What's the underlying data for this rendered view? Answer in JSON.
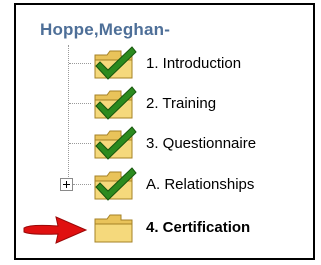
{
  "tree": {
    "user_name": "Hoppe,Meghan-",
    "items": [
      {
        "label": "1. Introduction",
        "status": "complete"
      },
      {
        "label": "2. Training",
        "status": "complete"
      },
      {
        "label": "3. Questionnaire",
        "status": "complete"
      },
      {
        "label": "A. Relationships",
        "status": "complete",
        "expandable": true
      },
      {
        "label": "4. Certification",
        "status": "current"
      }
    ]
  },
  "icons": {
    "folder": "folder-icon",
    "checkmark": "checkmark-icon",
    "expand": "plus-expander-icon",
    "pointer": "red-arrow-icon"
  },
  "colors": {
    "header_text": "#4e6f98",
    "folder_fill": "#f0cf6a",
    "check_green": "#2c8a1e",
    "arrow_red": "#e01010"
  }
}
